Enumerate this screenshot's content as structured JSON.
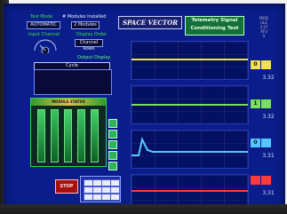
{
  "app": {
    "title": "SPACE VECTOR",
    "subtitle": "Telemetry Signal Conditioning Test"
  },
  "left": {
    "test_mode_label": "Test Mode",
    "test_mode_value": "AUTOMATIC",
    "modules_label": "# Modules Installed",
    "modules_value": "2 Modules",
    "input_channel_label": "Input Channel",
    "display_order_label": "Display Order",
    "display_order_value": "Channel Rows",
    "output_display_label": "Output Display",
    "output_display_value": "Cycle",
    "module_grid_title": "MODULE STATUS",
    "red_button_label": "STOP"
  },
  "plots": {
    "count": 4
  },
  "right": {
    "column_header": "MODULE 3 STATUS",
    "channels": [
      {
        "badge": "0",
        "badge_color": "#f1e14a",
        "value": "3.32"
      },
      {
        "badge": "1",
        "badge_color": "#78e05a",
        "value": "3.32"
      },
      {
        "badge": "0",
        "badge_color": "#57c6ff",
        "value": "3.31"
      },
      {
        "badge": "",
        "badge_color": "#ff3a3a",
        "value": "3.31"
      }
    ]
  }
}
